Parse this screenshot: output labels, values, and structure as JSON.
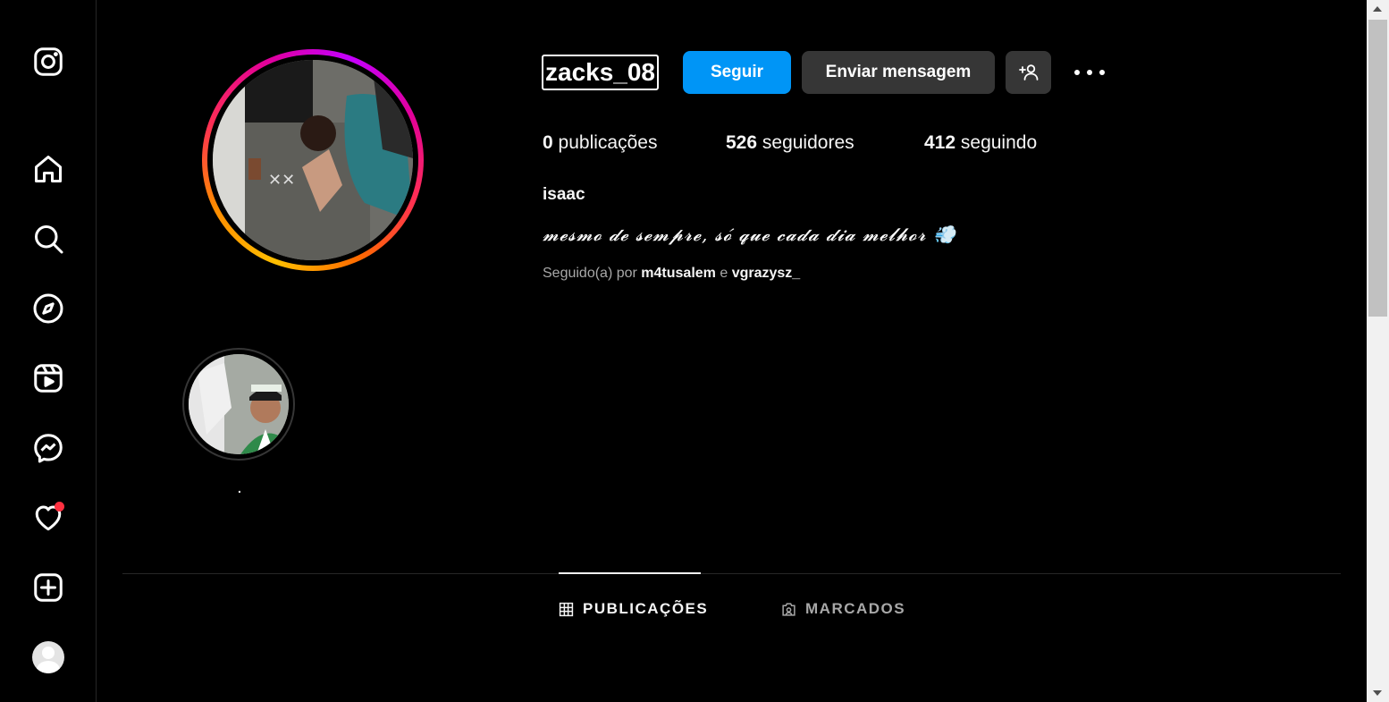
{
  "sidebar": {
    "items": [
      {
        "name": "instagram-logo-icon"
      },
      {
        "name": "home-icon"
      },
      {
        "name": "search-icon"
      },
      {
        "name": "explore-icon"
      },
      {
        "name": "reels-icon"
      },
      {
        "name": "messenger-icon"
      },
      {
        "name": "notifications-heart-icon",
        "has_badge": true
      },
      {
        "name": "create-icon"
      }
    ]
  },
  "profile": {
    "username": "zacks_08",
    "follow_label": "Seguir",
    "message_label": "Enviar mensagem",
    "posts_count": "0",
    "posts_label": "publicações",
    "followers_count": "526",
    "followers_label": "seguidores",
    "following_count": "412",
    "following_label": "seguindo",
    "full_name": "isaac",
    "bio": "𝓶𝓮𝓼𝓶𝓸 𝓭𝓮 𝓼𝓮𝓶𝓹𝓻𝓮, 𝓼𝓸́ 𝓺𝓾𝓮 𝓬𝓪𝓭𝓪 𝓭𝓲𝓪 𝓶𝓮𝓵𝓱𝓸𝓻 💨",
    "followed_by_prefix": "Seguido(a) por",
    "followed_by_user1": "m4tusalem",
    "followed_by_conj": "e",
    "followed_by_user2": "vgrazysz_"
  },
  "highlights": [
    {
      "label": "."
    }
  ],
  "tabs": [
    {
      "label": "PUBLICAÇÕES",
      "active": true
    },
    {
      "label": "MARCADOS",
      "active": false
    }
  ],
  "colors": {
    "background": "#000000",
    "primary_button": "#0095f6",
    "secondary_button": "#363636",
    "muted_text": "#a8a8a8",
    "notification_dot": "#ff3040"
  }
}
